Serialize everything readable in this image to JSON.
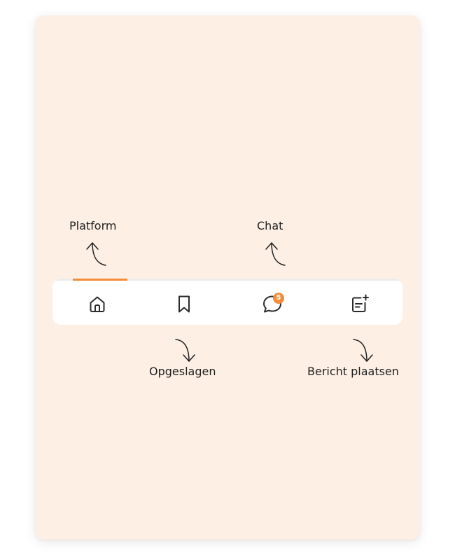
{
  "annotations": {
    "platform": "Platform",
    "chat": "Chat",
    "saved": "Opgeslagen",
    "post": "Bericht plaatsen"
  },
  "navbar": {
    "active_tab": "home",
    "accent_color": "#f28c3a",
    "items": [
      {
        "id": "home",
        "icon": "home-icon"
      },
      {
        "id": "saved",
        "icon": "bookmark-icon"
      },
      {
        "id": "chat",
        "icon": "chat-bubble-icon",
        "badge": "5"
      },
      {
        "id": "post",
        "icon": "new-post-icon"
      }
    ]
  },
  "colors": {
    "background": "#fdefe4",
    "navbar": "#ffffff",
    "accent": "#f28c3a",
    "icon": "#2b2b2b"
  }
}
